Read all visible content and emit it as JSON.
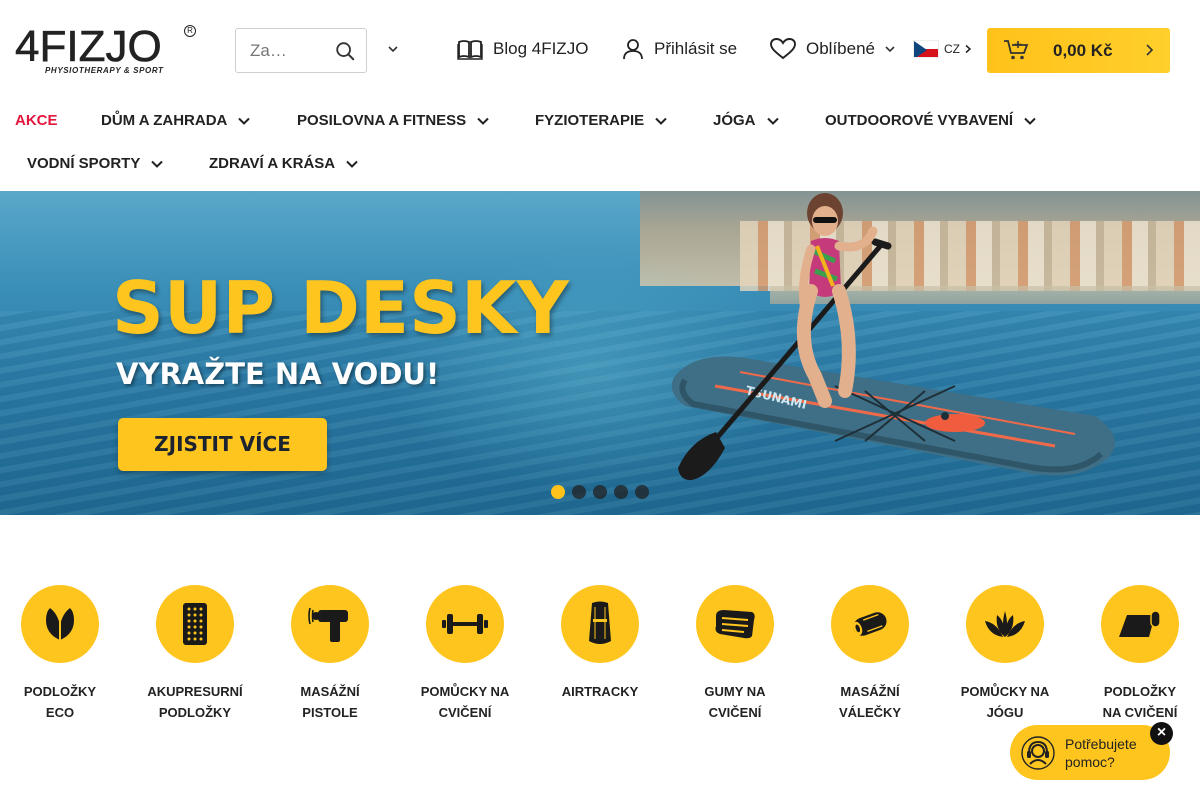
{
  "header": {
    "logo_text": "4FIZJO",
    "logo_tagline": "PHYSIOTHERAPY & SPORT",
    "search_placeholder": "Za…",
    "blog_label": "Blog 4FIZJO",
    "login_label": "Přihlásit se",
    "favorites_label": "Oblíbené",
    "language": "CZ",
    "cart_total": "0,00 Kč"
  },
  "nav": {
    "items": [
      {
        "label": "AKCE"
      },
      {
        "label": "DŮM A ZAHRADA"
      },
      {
        "label": "POSILOVNA A FITNESS"
      },
      {
        "label": "FYZIOTERAPIE"
      },
      {
        "label": "JÓGA"
      },
      {
        "label": "OUTDOOROVÉ VYBAVENÍ"
      },
      {
        "label": "VODNÍ SPORTY"
      },
      {
        "label": "ZDRAVÍ A KRÁSA"
      }
    ]
  },
  "hero": {
    "title": "SUP DESKY",
    "subtitle": "VYRAŽTE NA VODU!",
    "cta": "ZJISTIT VÍCE",
    "board_brand": "TSUNAMI",
    "slides_count": 5,
    "active_slide": 1
  },
  "categories": [
    {
      "line1": "PODLOŽKY",
      "line2": "ECO",
      "icon": "leaf-icon"
    },
    {
      "line1": "AKUPRESURNÍ",
      "line2": "PODLOŽKY",
      "icon": "acupressure-mat-icon"
    },
    {
      "line1": "MASÁŽNÍ",
      "line2": "PISTOLE",
      "icon": "massage-gun-icon"
    },
    {
      "line1": "POMŮCKY NA",
      "line2": "CVIČENÍ",
      "icon": "dumbbell-icon"
    },
    {
      "line1": "AIRTRACKY",
      "line2": "",
      "icon": "airtrack-icon"
    },
    {
      "line1": "GUMY NA",
      "line2": "CVIČENÍ",
      "icon": "resistance-band-icon"
    },
    {
      "line1": "MASÁŽNÍ",
      "line2": "VÁLEČKY",
      "icon": "foam-roller-icon"
    },
    {
      "line1": "POMŮCKY NA",
      "line2": "JÓGU",
      "icon": "lotus-icon"
    },
    {
      "line1": "PODLOŽKY",
      "line2": "NA CVIČENÍ",
      "icon": "exercise-mat-icon"
    }
  ],
  "help": {
    "text": "Potřebujete pomoc?",
    "close": "×"
  },
  "colors": {
    "accent": "#ffc51f",
    "sale": "#e3173e",
    "text": "#222222"
  }
}
